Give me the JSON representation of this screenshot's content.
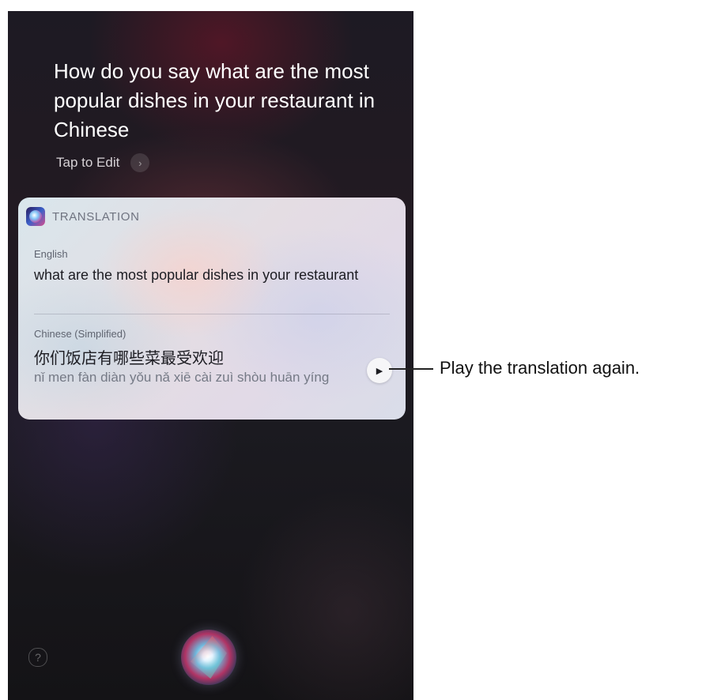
{
  "siri": {
    "query": "How do you say what are the most popular dishes in your restaurant in Chinese",
    "tap_to_edit": "Tap to Edit",
    "chevron_icon": "chevron-right"
  },
  "translation_card": {
    "title": "TRANSLATION",
    "source_language": "English",
    "source_text": "what are the most popular dishes in your restaurant",
    "target_language": "Chinese (Simplified)",
    "target_text": "你们饭店有哪些菜最受欢迎",
    "pinyin": "nǐ men fàn diàn yǒu nǎ xiē cài zuì shòu huān yíng",
    "play_icon": "▶"
  },
  "footer": {
    "help_icon": "?"
  },
  "callout": {
    "text": "Play the translation again."
  }
}
